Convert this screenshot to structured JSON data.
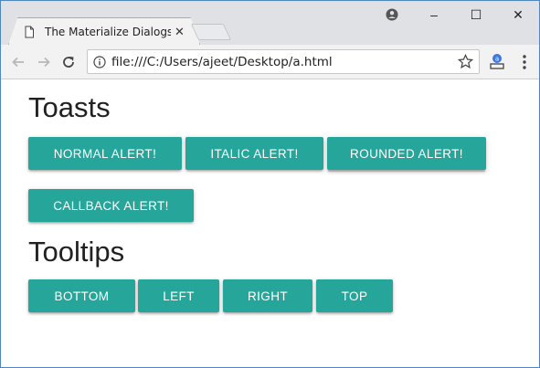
{
  "browser": {
    "tab_title": "The Materialize Dialogs E",
    "tab_close": "✕",
    "url": "file:///C:/Users/ajeet/Desktop/a.html",
    "window_controls": {
      "minimize": "–",
      "maximize": "☐",
      "close": "✕"
    }
  },
  "page": {
    "toasts_heading": "Toasts",
    "toast_buttons": [
      "NORMAL ALERT!",
      "ITALIC ALERT!",
      "ROUNDED ALERT!",
      "CALLBACK ALERT!"
    ],
    "tooltips_heading": "Tooltips",
    "tooltip_buttons": [
      "BOTTOM",
      "LEFT",
      "RIGHT",
      "TOP"
    ]
  },
  "colors": {
    "button": "#26a69a",
    "window_border": "#4f86c6"
  },
  "icons": [
    "page-icon",
    "profile-icon",
    "back-arrow-icon",
    "forward-arrow-icon",
    "reload-icon",
    "info-icon",
    "star-icon",
    "extension-icon",
    "menu-icon"
  ]
}
